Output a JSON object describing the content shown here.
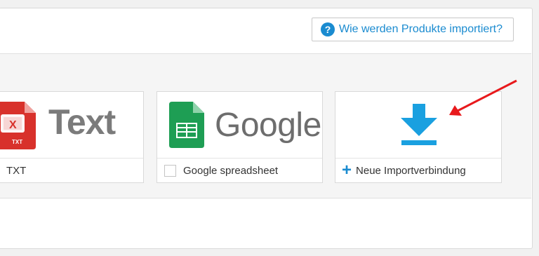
{
  "header": {
    "help_button_label": "Wie werden Produkte importiert?",
    "help_icon": "question-circle-icon"
  },
  "cards": [
    {
      "footer_label": "TXT",
      "logo_text": "Text",
      "icon_label": "TXT"
    },
    {
      "footer_label": "Google spreadsheet",
      "logo_text": "Google"
    },
    {
      "footer_label": "Neue Importverbindung",
      "icon": "download-icon",
      "footer_icon": "plus-icon"
    }
  ],
  "colors": {
    "accent": "#1a8bd0",
    "download_icon": "#1aa0e0",
    "annotation_arrow": "#e8191c",
    "google_sheets": "#1e9e54",
    "txt_file": "#d8312b"
  }
}
